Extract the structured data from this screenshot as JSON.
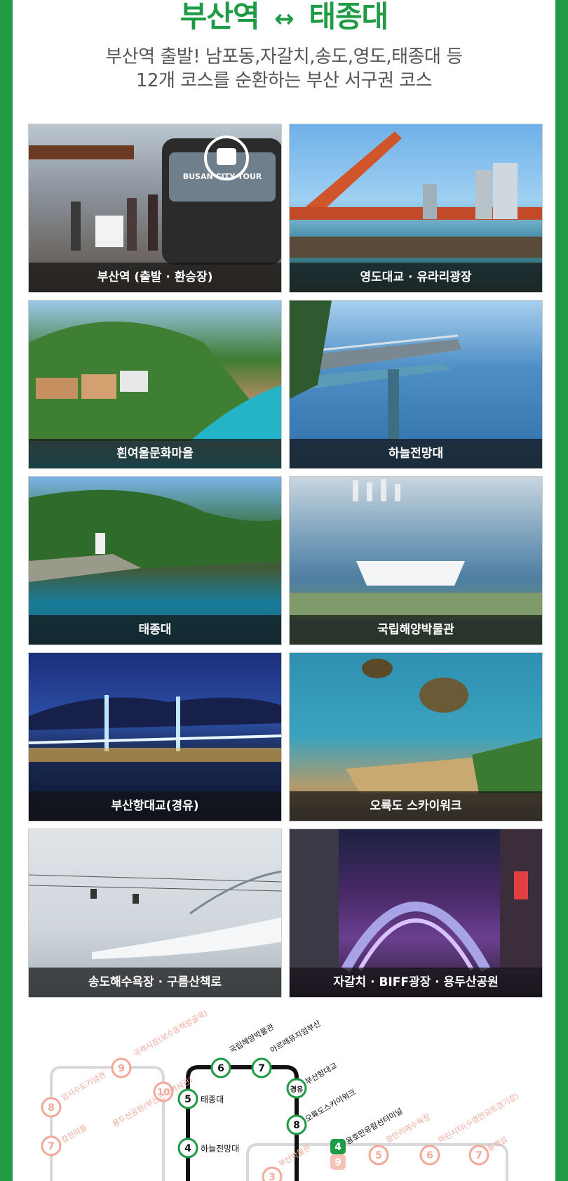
{
  "header": {
    "route_from": "부산역",
    "route_arrow": "↔",
    "route_to": "태종대",
    "subtitle_line1": "부산역 출발! 남포동,자갈치,송도,영도,태종대 등",
    "subtitle_line2": "12개 코스를 순환하는 부산 서구권 코스"
  },
  "colors": {
    "frame": "#1f9a45",
    "title": "#1f9a45",
    "subtitle": "#555555",
    "route_line": "#111111",
    "route_badge": "#1f9a45",
    "faded_badge": "#f2a99a"
  },
  "attractions": [
    {
      "name": "부산역 (출발 · 환승장)",
      "bus_logo_text": "BUSAN CITY TOUR"
    },
    {
      "name": "영도대교 · 유라리광장"
    },
    {
      "name": "흰여울문화마을"
    },
    {
      "name": "하늘전망대"
    },
    {
      "name": "태종대"
    },
    {
      "name": "국립해양박물관"
    },
    {
      "name": "부산항대교(경유)"
    },
    {
      "name": "오륙도 스카이워크"
    },
    {
      "name": "송도해수욕장 · 구름산책로"
    },
    {
      "name": "자갈치 · BIFF광장 · 용두산공원"
    }
  ],
  "route_map": {
    "active_stops": [
      {
        "badge": "6",
        "label": "국립해양박물관"
      },
      {
        "badge": "7",
        "label": "아르떼뮤지엄부산"
      },
      {
        "badge": "경유",
        "label": "부산항대교"
      },
      {
        "badge": "5",
        "label": "태종대"
      },
      {
        "badge": "8",
        "label": "오륙도스카이워크"
      },
      {
        "badge": "4",
        "label": "하늘전망대"
      },
      {
        "badge": "4",
        "label": "용호만유람선터미널"
      }
    ],
    "faded_stops": [
      {
        "badge": "9",
        "label": "국제시장(보수동책방골목)"
      },
      {
        "badge": "8",
        "label": "임시수도기념관"
      },
      {
        "badge": "10",
        "label": "용두산공원(부산근대역사관)"
      },
      {
        "badge": "7",
        "label": "감천마을"
      },
      {
        "badge": "9",
        "label": ""
      },
      {
        "badge": "5",
        "label": "광안리해수욕장"
      },
      {
        "badge": "6",
        "label": "마린시티(수영만요트경기장)"
      },
      {
        "badge": "7",
        "label": "동백섬"
      },
      {
        "badge": "3",
        "label": "부산박물관"
      }
    ]
  }
}
